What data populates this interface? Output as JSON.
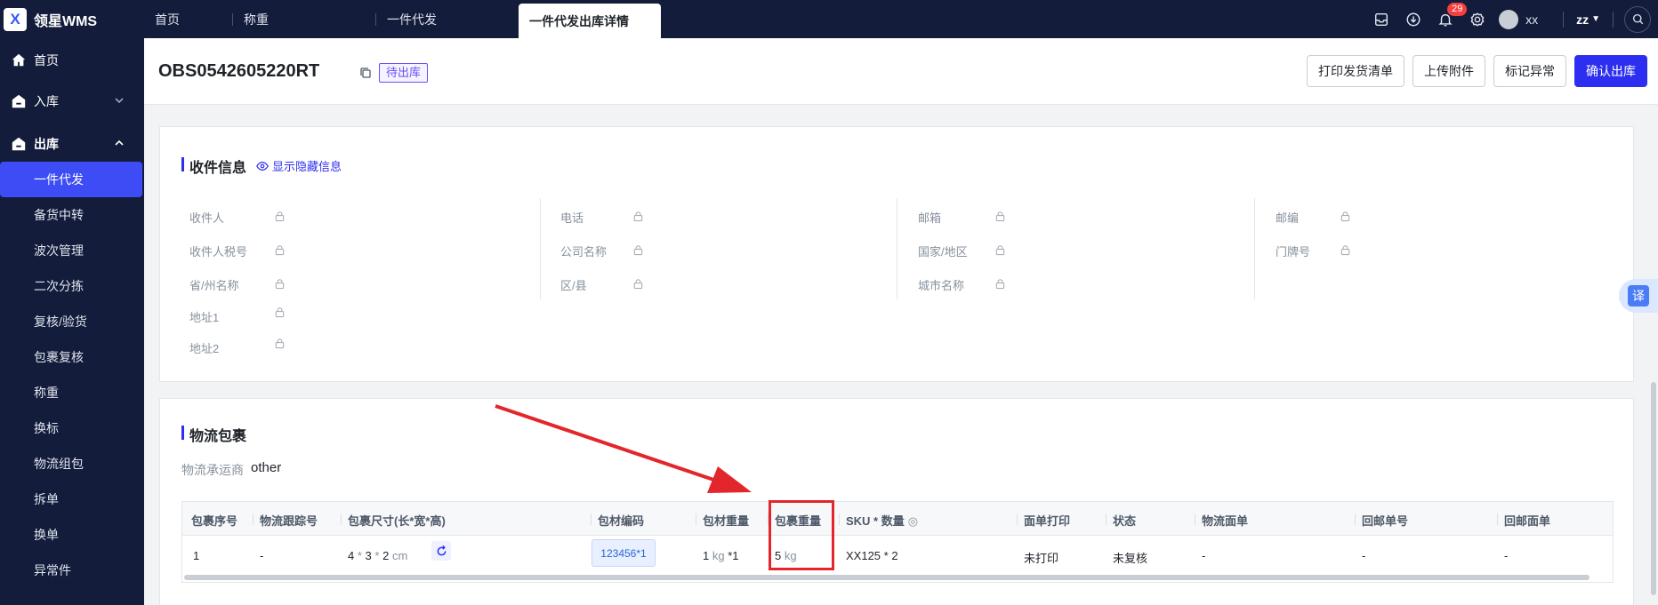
{
  "app": {
    "logo_mark": "X",
    "name": "领星WMS"
  },
  "tabs": [
    {
      "label": "首页"
    },
    {
      "label": "称重"
    },
    {
      "label": "一件代发"
    },
    {
      "label": "一件代发出库详情"
    }
  ],
  "topbar": {
    "notification_count": "29",
    "username": "xx",
    "tenant": "zz"
  },
  "sidebar": {
    "home": "首页",
    "inbound": "入库",
    "outbound": "出库",
    "sub_items": [
      "一件代发",
      "备货中转",
      "波次管理",
      "二次分拣",
      "复核/验货",
      "包裹复核",
      "称重",
      "换标",
      "物流组包",
      "拆单",
      "换单",
      "异常件"
    ]
  },
  "header": {
    "order_no": "OBS0542605220RT",
    "status": "待出库",
    "actions": {
      "print": "打印发货清单",
      "upload": "上传附件",
      "mark": "标记异常",
      "confirm": "确认出库"
    }
  },
  "recipient": {
    "title": "收件信息",
    "show_hidden": "显示隐藏信息",
    "fields": {
      "name": "收件人",
      "tax_no": "收件人税号",
      "province": "省/州名称",
      "address1": "地址1",
      "address2": "地址2",
      "phone": "电话",
      "company": "公司名称",
      "district": "区/县",
      "email": "邮箱",
      "country": "国家/地区",
      "city": "城市名称",
      "zip": "邮编",
      "house_no": "门牌号"
    }
  },
  "logistics": {
    "title": "物流包裹",
    "carrier_label": "物流承运商",
    "carrier_value": "other",
    "columns": {
      "seq": "包裹序号",
      "tracking": "物流跟踪号",
      "size": "包裹尺寸(长*宽*高)",
      "material_code": "包材编码",
      "material_weight": "包材重量",
      "package_weight": "包裹重量",
      "sku_qty": "SKU * 数量",
      "label_print": "面单打印",
      "status": "状态",
      "logistics_label": "物流面单",
      "return_no": "回邮单号",
      "return_label": "回邮面单"
    },
    "row": {
      "seq": "1",
      "tracking": "-",
      "size_l": "4",
      "size_x1": "*",
      "size_w": "3",
      "size_x2": "*",
      "size_h": "2",
      "size_unit": "cm",
      "material_code": "123456*1",
      "material_weight": "1",
      "material_unit": "kg",
      "material_qty": "*1",
      "package_weight": "5",
      "package_unit": "kg",
      "sku_qty": "XX125 * 2",
      "label_print": "未打印",
      "status": "未复核",
      "logistics_label": "-",
      "return_no": "-",
      "return_label": "-"
    }
  },
  "translate": "译",
  "colors": {
    "accent": "#2d2ff0",
    "nav_bg": "#131c3a",
    "highlight": "#e3262b"
  }
}
